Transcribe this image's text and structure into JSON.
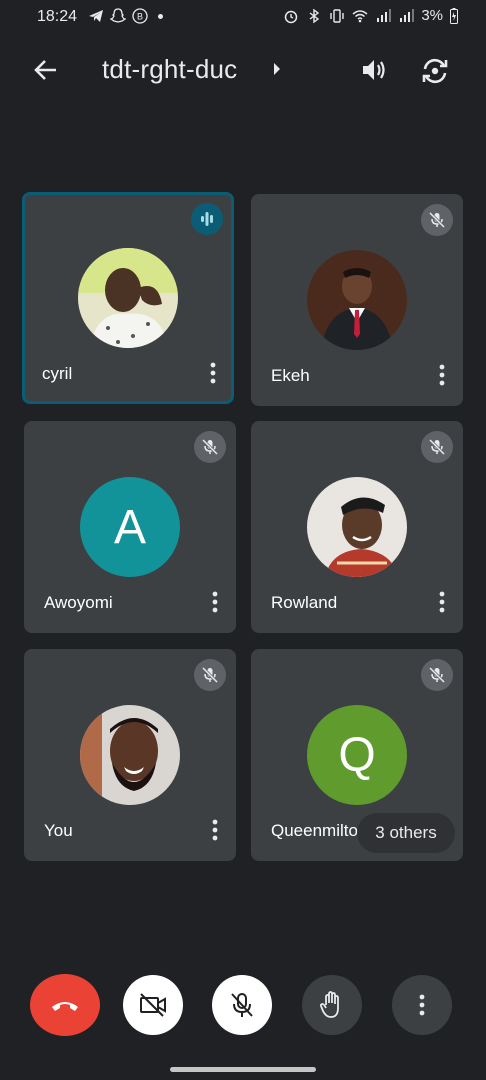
{
  "status_bar": {
    "time": "18:24",
    "battery": "3%",
    "icons": [
      "telegram-icon",
      "snapchat-icon",
      "b-icon",
      "dot",
      "alarm-icon",
      "bluetooth-icon",
      "vibrate-icon",
      "wifi-icon",
      "signal-icon",
      "signal-icon",
      "battery-icon"
    ]
  },
  "header": {
    "meeting_code": "tdt-rght-duc",
    "icons": [
      "back-arrow-icon",
      "chevron-right-icon",
      "speaker-icon",
      "switch-camera-icon"
    ]
  },
  "participants": [
    {
      "name": "cyril",
      "state": "speaking",
      "avatar": "photo"
    },
    {
      "name": "Ekeh",
      "state": "muted",
      "avatar": "photo"
    },
    {
      "name": "Awoyomi",
      "state": "muted",
      "avatar": "letter",
      "letter": "A",
      "color": "#12939a"
    },
    {
      "name": "Rowland",
      "state": "muted",
      "avatar": "photo"
    },
    {
      "name": "You",
      "state": "muted",
      "avatar": "photo"
    },
    {
      "name": "Queenmilton",
      "state": "muted",
      "avatar": "letter",
      "letter": "Q",
      "color": "#5f9c2d"
    }
  ],
  "others_pill": "3 others",
  "controls": [
    {
      "name": "end-call",
      "icon": "hangup-icon",
      "color": "#ea4335"
    },
    {
      "name": "camera",
      "icon": "camera-off-icon",
      "state": "off"
    },
    {
      "name": "microphone",
      "icon": "mic-off-icon",
      "state": "off"
    },
    {
      "name": "raise-hand",
      "icon": "hand-icon"
    },
    {
      "name": "more-options",
      "icon": "more-vert-icon"
    }
  ],
  "colors": {
    "background": "#202124",
    "tile": "#3c4043",
    "active_border": "#0b5c75",
    "hangup": "#ea4335"
  }
}
